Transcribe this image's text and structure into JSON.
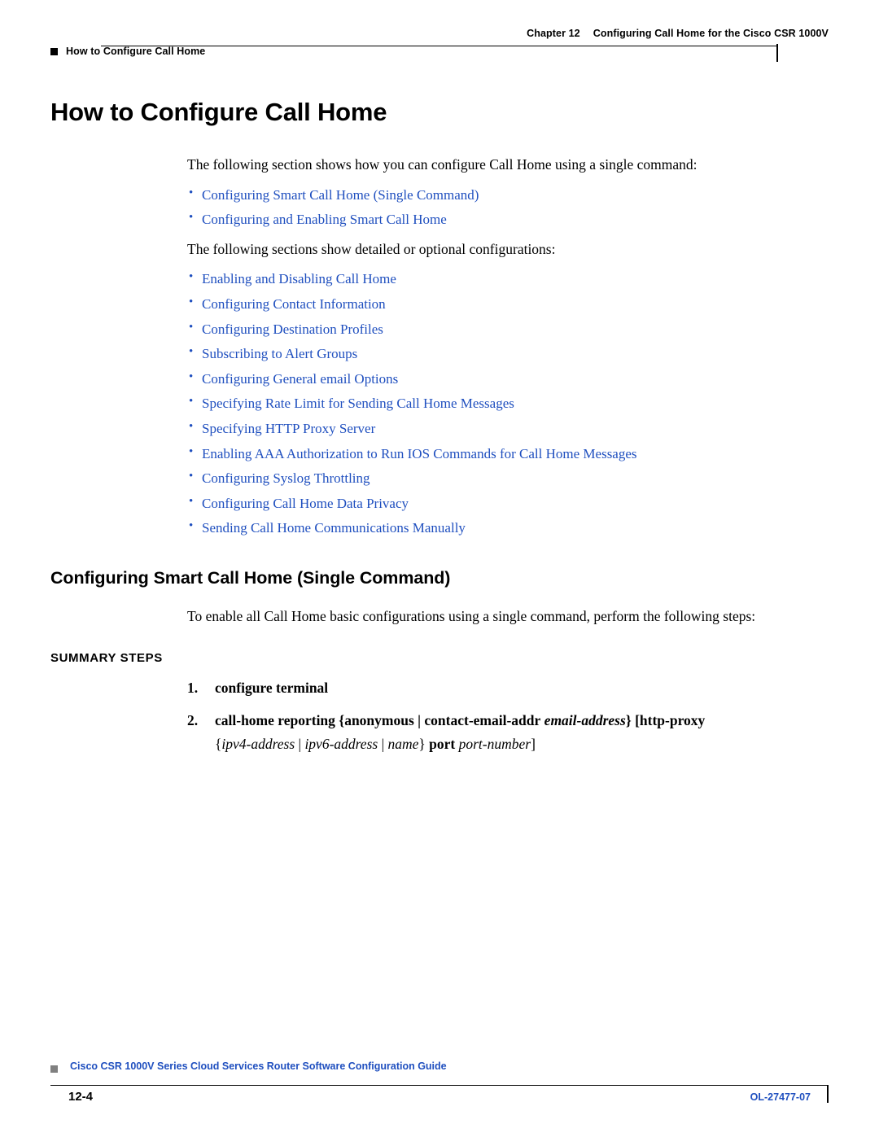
{
  "header": {
    "left_marker": "square-marker",
    "left_text": "How to Configure Call Home",
    "chapter_label": "Chapter 12",
    "chapter_title": "Configuring Call Home for the Cisco CSR 1000V"
  },
  "main": {
    "h1": "How to Configure Call Home",
    "intro_1": "The following section shows how you can configure Call Home using a single command:",
    "links_1": [
      "Configuring Smart Call Home (Single Command)",
      "Configuring and Enabling Smart Call Home"
    ],
    "intro_2": "The following sections show detailed or optional configurations:",
    "links_2": [
      "Enabling and Disabling Call Home",
      "Configuring Contact Information",
      "Configuring Destination Profiles",
      "Subscribing to Alert Groups",
      "Configuring General email Options",
      "Specifying Rate Limit for Sending Call Home Messages",
      "Specifying HTTP Proxy Server",
      "Enabling AAA Authorization to Run IOS Commands for Call Home Messages",
      "Configuring Syslog Throttling",
      "Configuring Call Home Data Privacy",
      "Sending Call Home Communications Manually"
    ],
    "h2": "Configuring Smart Call Home (Single Command)",
    "intro_3": "To enable all Call Home basic configurations using a single command, perform the following steps:",
    "summary_steps_label": "SUMMARY STEPS",
    "steps": [
      {
        "num": "1.",
        "parts": [
          {
            "text": "configure terminal",
            "style": "bold"
          }
        ]
      },
      {
        "num": "2.",
        "parts": [
          {
            "text": "call-home reporting",
            "style": "bold"
          },
          {
            "text": " {",
            "style": "bold"
          },
          {
            "text": "anonymous",
            "style": "bold"
          },
          {
            "text": " | ",
            "style": "bold"
          },
          {
            "text": "contact-email-addr",
            "style": "bold"
          },
          {
            "text": " ",
            "style": "plain"
          },
          {
            "text": "email-address",
            "style": "bold-italic"
          },
          {
            "text": "} [",
            "style": "bold"
          },
          {
            "text": "http-proxy",
            "style": "bold"
          }
        ],
        "continuation": [
          {
            "text": "{",
            "style": "plain"
          },
          {
            "text": "ipv4-address",
            "style": "italic"
          },
          {
            "text": " | ",
            "style": "plain"
          },
          {
            "text": "ipv6-address",
            "style": "italic"
          },
          {
            "text": " | ",
            "style": "plain"
          },
          {
            "text": "name",
            "style": "italic"
          },
          {
            "text": "} ",
            "style": "plain"
          },
          {
            "text": "port",
            "style": "bold"
          },
          {
            "text": " ",
            "style": "plain"
          },
          {
            "text": "port-number",
            "style": "italic"
          },
          {
            "text": "]",
            "style": "plain"
          }
        ]
      }
    ]
  },
  "footer": {
    "title": "Cisco CSR 1000V Series Cloud Services Router Software Configuration Guide",
    "page_number": "12-4",
    "doc_id": "OL-27477-07"
  },
  "colors": {
    "link": "#1f4fbf",
    "text": "#000000",
    "footer_marker": "#808080"
  }
}
